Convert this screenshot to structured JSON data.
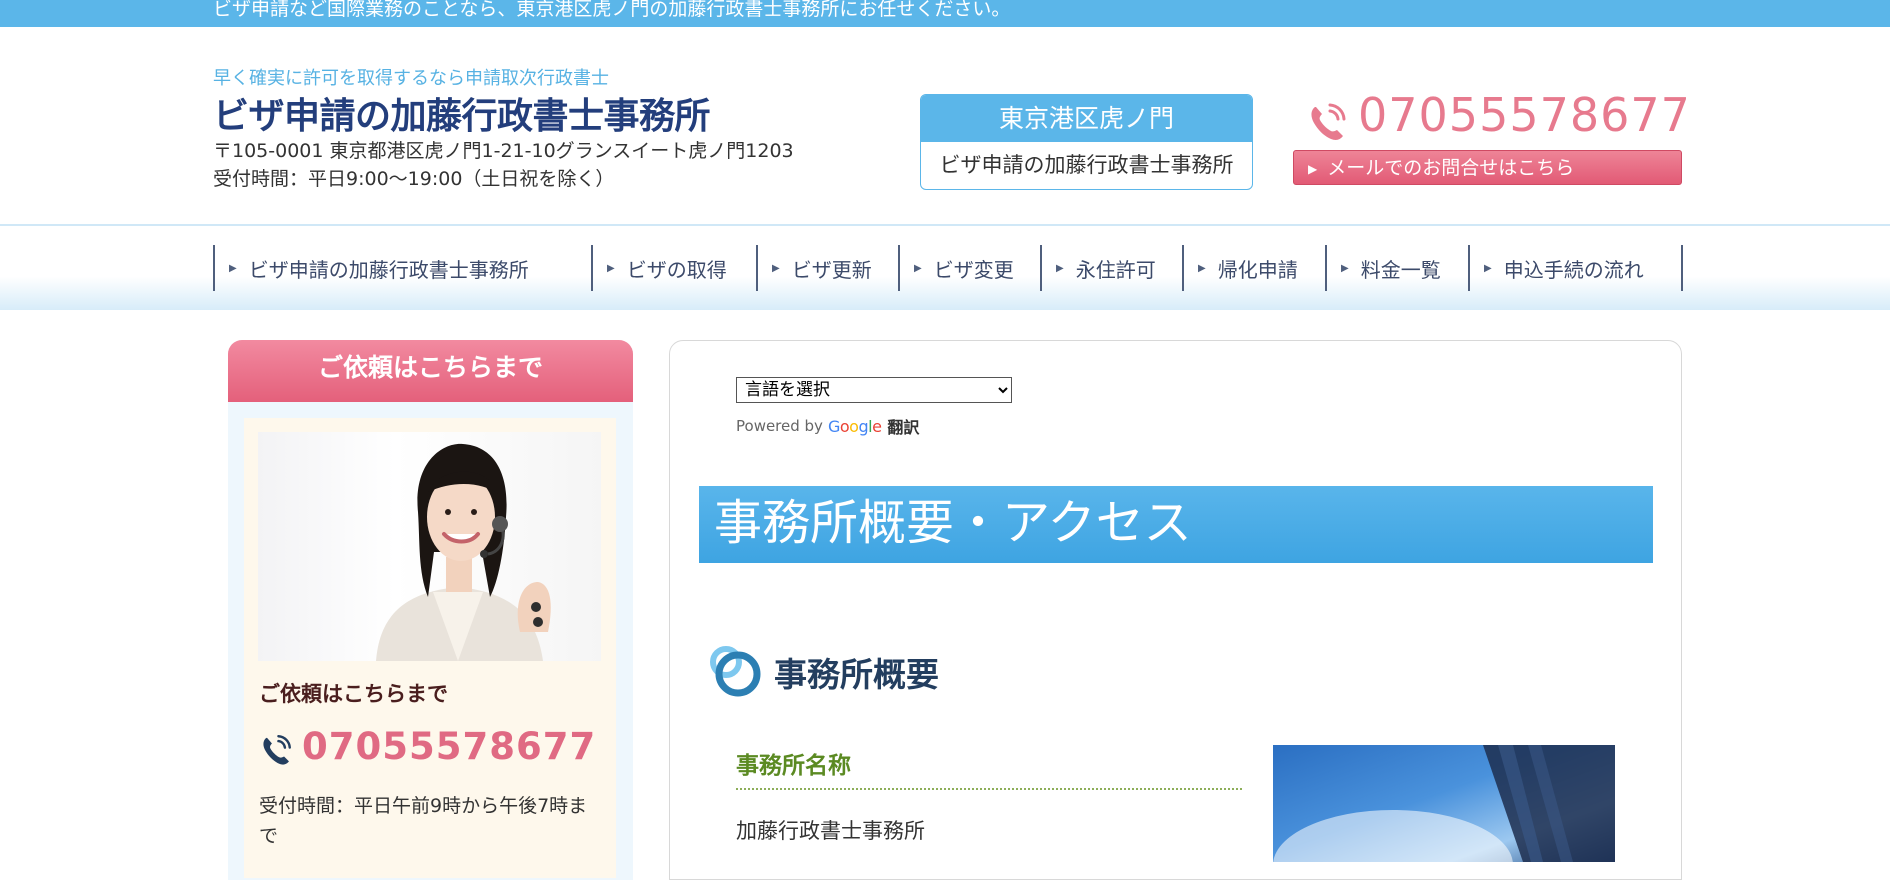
{
  "topbar": {
    "text": "ビザ申請など国際業務のことなら、東京港区虎ノ門の加藤行政書士事務所にお任せください。"
  },
  "header": {
    "tagline": "早く確実に許可を取得するなら申請取次行政書士",
    "title": "ビザ申請の加藤行政書士事務所",
    "address": "〒105-0001 東京都港区虎ノ門1-21-10グランスイート虎ノ門1203",
    "hours": "受付時間：平日9:00～19:00（土日祝を除く）",
    "location_box": {
      "top": "東京港区虎ノ門",
      "bottom": "ビザ申請の加藤行政書士事務所"
    },
    "phone": "07055578677",
    "mail_button": "メールでのお問合せはこちら"
  },
  "nav": {
    "items": [
      {
        "label": "ビザ申請の加藤行政書士事務所"
      },
      {
        "label": "ビザの取得"
      },
      {
        "label": "ビザ更新"
      },
      {
        "label": "ビザ変更"
      },
      {
        "label": "永住許可"
      },
      {
        "label": "帰化申請"
      },
      {
        "label": "料金一覧"
      },
      {
        "label": "申込手続の流れ"
      }
    ]
  },
  "sidebar": {
    "heading": "ご依頼はこちらまで",
    "subheading": "ご依頼はこちらまで",
    "phone": "07055578677",
    "hours": "受付時間：平日午前9時から午後7時まで"
  },
  "main": {
    "language_select": {
      "selected": "言語を選択"
    },
    "powered_by": "Powered by",
    "google": "Google",
    "translate": "翻訳",
    "page_heading": "事務所概要・アクセス",
    "section_title": "事務所概要",
    "field_label": "事務所名称",
    "field_value": "加藤行政書士事務所"
  },
  "colors": {
    "accent_blue": "#5bb6e9",
    "brand_navy": "#233e7c",
    "pink": "#e77a8e",
    "green_label": "#5b8a22"
  },
  "icons": {
    "phone": "phone-icon",
    "nav_arrow": "triangle-right-icon",
    "section": "ring-icon"
  }
}
